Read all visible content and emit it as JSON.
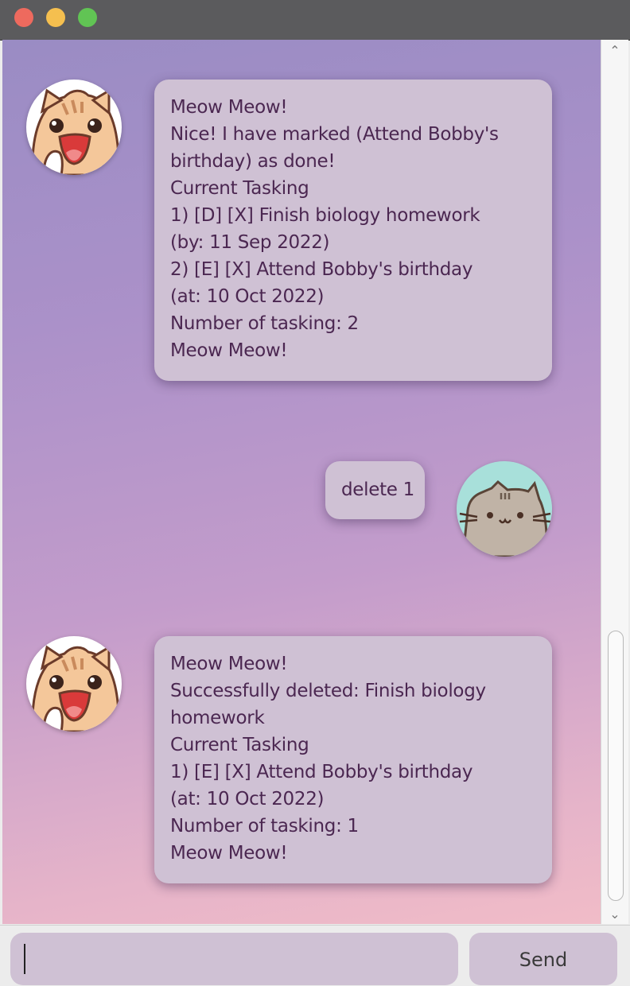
{
  "window": {
    "buttons": [
      "close",
      "minimize",
      "maximize"
    ]
  },
  "messages": [
    {
      "sender": "bot",
      "avatar_icon": "cat-mascot-icon",
      "lines": [
        "Meow Meow!",
        "Nice! I have marked (Attend Bobby's",
        "birthday) as done!",
        "Current Tasking",
        "1) [D] [X] Finish biology homework",
        "(by: 11 Sep 2022)",
        "2) [E] [X] Attend Bobby's birthday",
        "(at: 10 Oct 2022)",
        "Number of tasking: 2",
        "Meow Meow!"
      ]
    },
    {
      "sender": "user",
      "avatar_icon": "pusheen-cat-icon",
      "lines": [
        "delete 1"
      ]
    },
    {
      "sender": "bot",
      "avatar_icon": "cat-mascot-icon",
      "lines": [
        "Meow Meow!",
        "Successfully deleted: Finish biology",
        "homework",
        "Current Tasking",
        "1) [E] [X] Attend Bobby's birthday",
        "(at: 10 Oct 2022)",
        "Number of tasking: 1",
        "Meow Meow!"
      ]
    }
  ],
  "input": {
    "value": "",
    "placeholder": ""
  },
  "send_button": {
    "label": "Send"
  },
  "colors": {
    "bubble_bg": "#cfc1d4",
    "bubble_text": "#4b2751",
    "bg_top": "#9a8cc4",
    "bg_bottom": "#f1bcc8"
  }
}
